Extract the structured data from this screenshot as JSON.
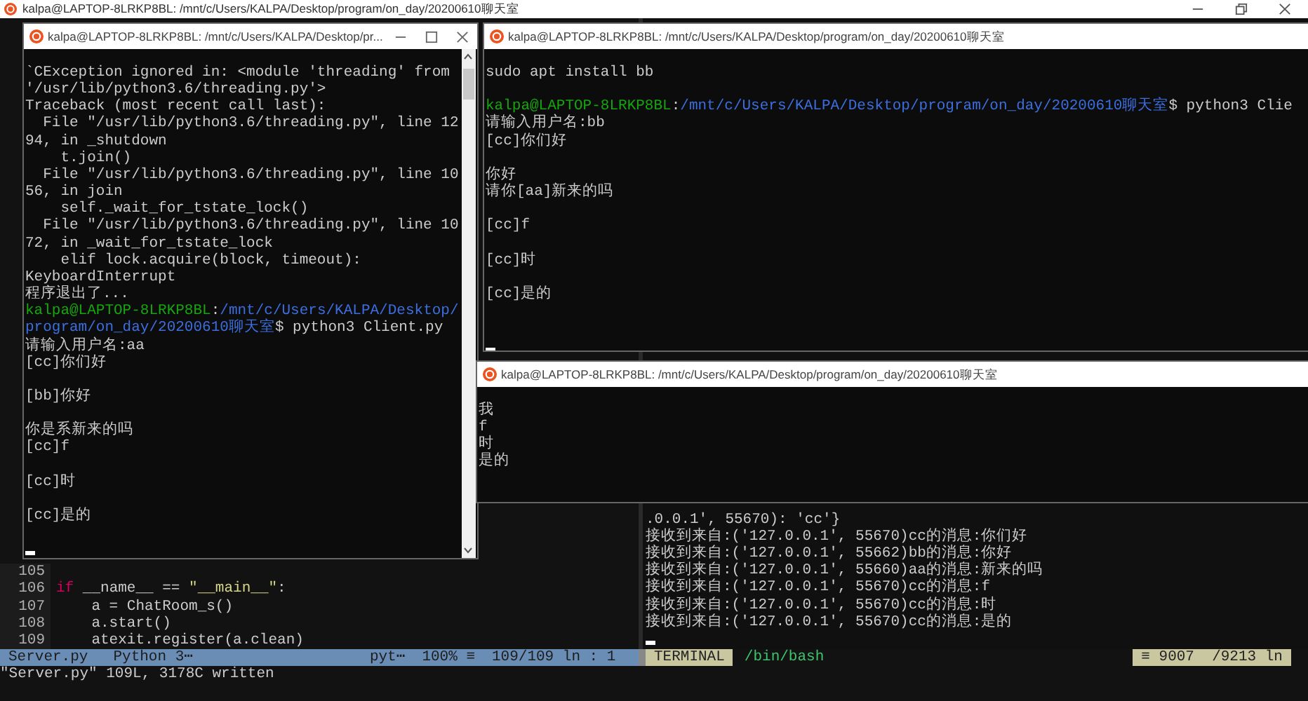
{
  "background_window": {
    "title": "kalpa@LAPTOP-8LRKP8BL: /mnt/c/Users/KALPA/Desktop/program/on_day/20200610聊天室",
    "editor": {
      "lines": [
        {
          "number": "105"
        },
        {
          "number": "106",
          "tokens": [
            {
              "kind": "keyword",
              "text": "if"
            },
            {
              "kind": "plain",
              "text": " __name__ == "
            },
            {
              "kind": "string",
              "text": "\"__main__\""
            },
            {
              "kind": "plain",
              "text": ":"
            }
          ]
        },
        {
          "number": "107",
          "tokens": [
            {
              "kind": "plain",
              "text": "    a = ChatRoom_s()"
            }
          ]
        },
        {
          "number": "108",
          "tokens": [
            {
              "kind": "plain",
              "text": "    a.start()"
            }
          ]
        },
        {
          "number": "109",
          "tokens": [
            {
              "kind": "plain",
              "text": "    atexit.register(a.clean)"
            }
          ]
        }
      ],
      "status": {
        "file": "Server.py",
        "filetype": "Python 3⋯",
        "encoding": "pyt⋯",
        "percent": "100% ≡",
        "position": "109/109 ln : 1"
      },
      "message": "\"Server.py\" 109L, 3178C written"
    },
    "terminal": {
      "cursor": true,
      "lines": [
        {
          "kind": "text",
          "text": ".0.0.1', 55670): 'cc'}"
        },
        {
          "kind": "text",
          "text": "接收到来自:('127.0.0.1', 55670)cc的消息:你们好"
        },
        {
          "kind": "text",
          "text": "接收到来自:('127.0.0.1', 55662)bb的消息:你好"
        },
        {
          "kind": "text",
          "text": "接收到来自:('127.0.0.1', 55660)aa的消息:新来的吗"
        },
        {
          "kind": "text",
          "text": "接收到来自:('127.0.0.1', 55670)cc的消息:f"
        },
        {
          "kind": "text",
          "text": "接收到来自:('127.0.0.1', 55670)cc的消息:时"
        },
        {
          "kind": "text",
          "text": "接收到来自:('127.0.0.1', 55670)cc的消息:是的"
        }
      ],
      "status": {
        "mode": "TERMINAL",
        "shell": "/bin/bash",
        "position": "≡ 9007  /9213 ln"
      }
    }
  },
  "windows": [
    {
      "title": "kalpa@LAPTOP-8LRKP8BL: /mnt/c/Users/KALPA/Desktop/pr...",
      "controls": true,
      "scrollbar": true,
      "cursor": true,
      "lines": [
        {
          "kind": "text",
          "text": "`CException ignored in: <module 'threading' from"
        },
        {
          "kind": "text",
          "text": "'/usr/lib/python3.6/threading.py'>"
        },
        {
          "kind": "text",
          "text": "Traceback (most recent call last):"
        },
        {
          "kind": "text",
          "text": "  File \"/usr/lib/python3.6/threading.py\", line 12"
        },
        {
          "kind": "text",
          "text": "94, in _shutdown"
        },
        {
          "kind": "text",
          "text": "    t.join()"
        },
        {
          "kind": "text",
          "text": "  File \"/usr/lib/python3.6/threading.py\", line 10"
        },
        {
          "kind": "text",
          "text": "56, in join"
        },
        {
          "kind": "text",
          "text": "    self._wait_for_tstate_lock()"
        },
        {
          "kind": "text",
          "text": "  File \"/usr/lib/python3.6/threading.py\", line 10"
        },
        {
          "kind": "text",
          "text": "72, in _wait_for_tstate_lock"
        },
        {
          "kind": "text",
          "text": "    elif lock.acquire(block, timeout):"
        },
        {
          "kind": "text",
          "text": "KeyboardInterrupt"
        },
        {
          "kind": "text",
          "text": "程序退出了..."
        },
        {
          "kind": "prompt",
          "user": "kalpa@LAPTOP-8LRKP8BL",
          "separator": ":",
          "path": "/mnt/c/Users/KALPA/Desktop/program/on_day/20200610聊天室",
          "command": "$ python3 Client.py"
        },
        {
          "kind": "text",
          "text": "请输入用户名:aa"
        },
        {
          "kind": "text",
          "text": "[cc]你们好"
        },
        {
          "kind": "blank"
        },
        {
          "kind": "text",
          "text": "[bb]你好"
        },
        {
          "kind": "blank"
        },
        {
          "kind": "text",
          "text": "你是系新来的吗"
        },
        {
          "kind": "text",
          "text": "[cc]f"
        },
        {
          "kind": "blank"
        },
        {
          "kind": "text",
          "text": "[cc]时"
        },
        {
          "kind": "blank"
        },
        {
          "kind": "text",
          "text": "[cc]是的"
        },
        {
          "kind": "blank"
        }
      ]
    },
    {
      "title": "kalpa@LAPTOP-8LRKP8BL: /mnt/c/Users/KALPA/Desktop/program/on_day/20200610聊天室",
      "controls": false,
      "scrollbar": false,
      "cursor": true,
      "lines": [
        {
          "kind": "text",
          "text": "sudo apt install bb"
        },
        {
          "kind": "blank"
        },
        {
          "kind": "prompt",
          "user": "kalpa@LAPTOP-8LRKP8BL",
          "separator": ":",
          "path": "/mnt/c/Users/KALPA/Desktop/program/on_day/20200610聊天室",
          "command": "$ python3 Clie"
        },
        {
          "kind": "text",
          "text": "请输入用户名:bb"
        },
        {
          "kind": "text",
          "text": "[cc]你们好"
        },
        {
          "kind": "blank"
        },
        {
          "kind": "text",
          "text": "你好"
        },
        {
          "kind": "text",
          "text": "请你[aa]新来的吗"
        },
        {
          "kind": "blank"
        },
        {
          "kind": "text",
          "text": "[cc]f"
        },
        {
          "kind": "blank"
        },
        {
          "kind": "text",
          "text": "[cc]时"
        },
        {
          "kind": "blank"
        },
        {
          "kind": "text",
          "text": "[cc]是的"
        },
        {
          "kind": "blank"
        },
        {
          "kind": "blank"
        }
      ]
    },
    {
      "title": "kalpa@LAPTOP-8LRKP8BL: /mnt/c/Users/KALPA/Desktop/program/on_day/20200610聊天室",
      "controls": false,
      "scrollbar": false,
      "cursor": false,
      "lines": [
        {
          "kind": "text",
          "text": "我"
        },
        {
          "kind": "text",
          "text": "f"
        },
        {
          "kind": "text",
          "text": "时"
        },
        {
          "kind": "text",
          "text": "是的"
        }
      ]
    }
  ]
}
